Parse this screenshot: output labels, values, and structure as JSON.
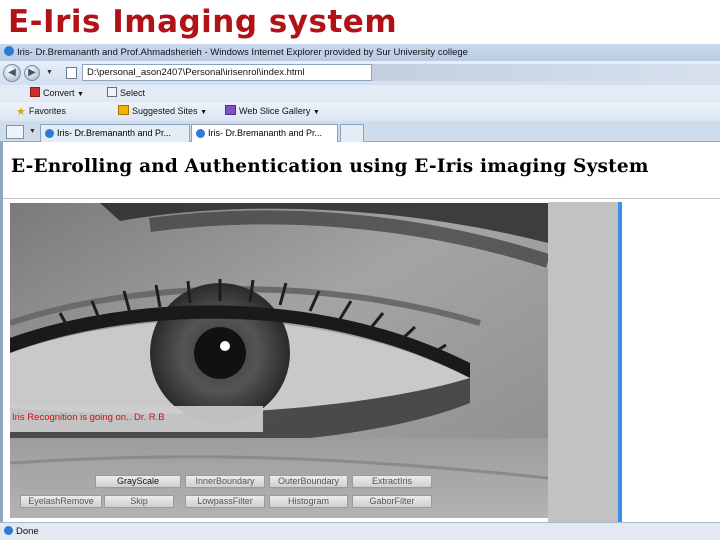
{
  "slide": {
    "title": "E-Iris Imaging system"
  },
  "browser": {
    "window_title": "Iris- Dr.Bremananth and Prof.Ahmadsherieh - Windows Internet Explorer provided by Sur University college",
    "address": "D:\\personal_ason2407\\Personal\\irisenrol\\index.html",
    "back_glyph": "◀",
    "forward_glyph": "▶",
    "command_bar": {
      "convert_label": "Convert",
      "select_label": "Select"
    },
    "favorites_bar": {
      "favorites_label": "Favorites",
      "suggested_label": "Suggested Sites",
      "gallery_label": "Web Slice Gallery"
    },
    "tabs": [
      {
        "label": "Iris- Dr.Bremananth and Pr..."
      },
      {
        "label": "Iris- Dr.Bremananth and Pr..."
      }
    ],
    "status_text": "Done"
  },
  "page": {
    "heading": "E-Enrolling and Authentication using E-Iris imaging System",
    "recognition_status": "Iris Recognition is going on.. Dr. R.B",
    "buttons_row1": [
      "GrayScale",
      "InnerBoundary",
      "OuterBoundary",
      "ExtractIris"
    ],
    "buttons_row2": [
      "EyelashRemove",
      "Skip",
      "LowpassFilter",
      "Histogram",
      "GaborFilter"
    ]
  },
  "colors": {
    "slide_title": "#b01217",
    "status_text": "#c81414",
    "accent_blue": "#3c8ee6"
  },
  "icons": [
    "internet-explorer-icon",
    "back-arrow-icon",
    "forward-arrow-icon",
    "page-icon",
    "convert-icon",
    "select-icon",
    "favorites-star-icon",
    "suggested-sites-icon",
    "web-slice-icon",
    "quick-tabs-icon"
  ]
}
